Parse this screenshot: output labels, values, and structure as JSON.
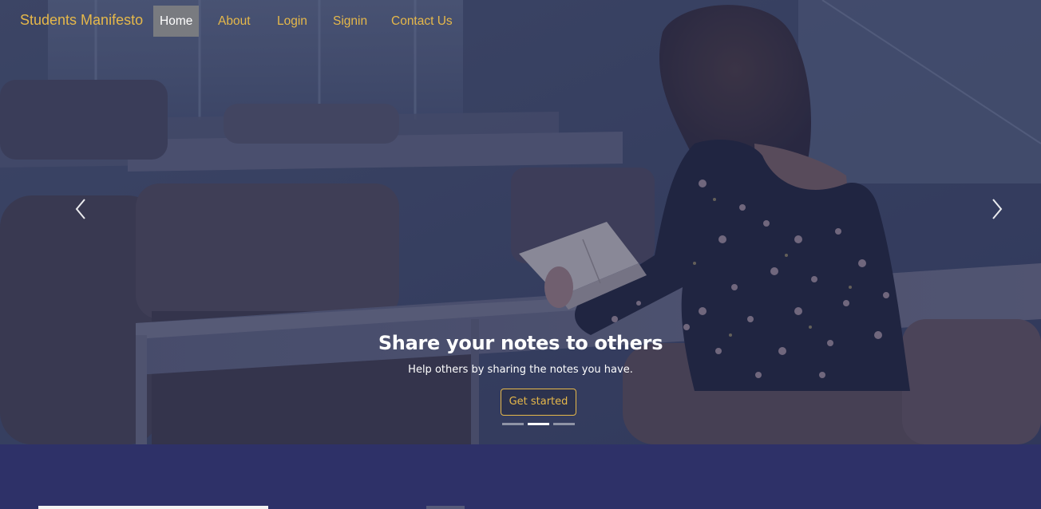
{
  "navbar": {
    "brand": "Students Manifesto",
    "items": [
      {
        "label": "Home",
        "active": true
      },
      {
        "label": "About",
        "active": false
      },
      {
        "label": "Login",
        "active": false
      },
      {
        "label": "Signin",
        "active": false
      },
      {
        "label": "Contact Us",
        "active": false
      }
    ]
  },
  "carousel": {
    "prev_icon": "chevron-left-icon",
    "next_icon": "chevron-right-icon",
    "slide": {
      "title": "Share your notes to others",
      "text": "Help others by sharing the notes you have.",
      "button_label": "Get started"
    },
    "indicators": {
      "count": 3,
      "active_index": 1
    }
  },
  "colors": {
    "accent": "#e6b84a",
    "band": "#2e3168",
    "overlay": "#212a54"
  }
}
